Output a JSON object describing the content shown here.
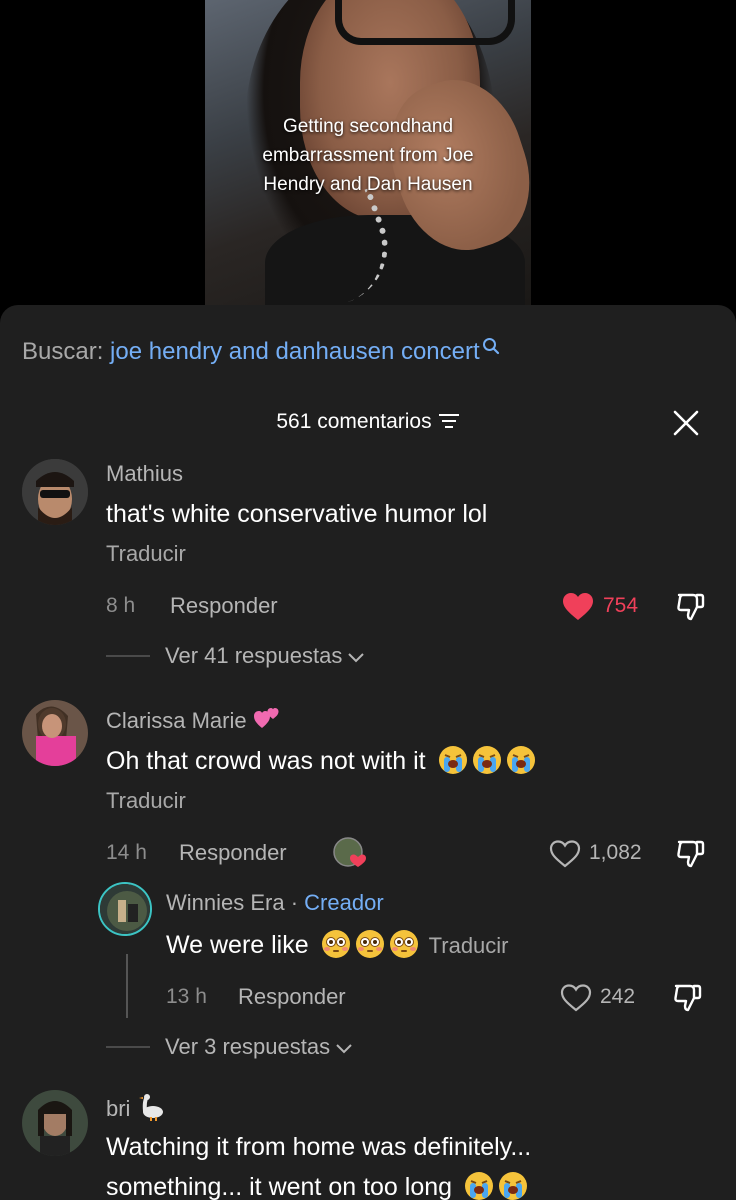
{
  "video": {
    "caption": "Getting secondhand embarrassment from Joe Hendry and Dan Hausen"
  },
  "search": {
    "prefix": "Buscar:",
    "query": "joe hendry and danhausen concert"
  },
  "comments_header": {
    "count_label": "561 comentarios"
  },
  "comments": [
    {
      "name": "Mathius",
      "text": "that's white conservative humor lol",
      "translate": "Traducir",
      "time": "8 h",
      "reply": "Responder",
      "likes": "754",
      "liked": true,
      "view_replies": "Ver 41 respuestas"
    },
    {
      "name": "Clarissa Marie",
      "text": "Oh that crowd was not with it",
      "translate": "Traducir",
      "time": "14 h",
      "reply": "Responder",
      "likes": "1,082",
      "liked": false,
      "reply_item": {
        "name": "Winnies Era",
        "separator": "·",
        "tag": "Creador",
        "text": "We were like",
        "translate": "Traducir",
        "time": "13 h",
        "reply": "Responder",
        "likes": "242"
      },
      "view_replies": "Ver 3 respuestas"
    },
    {
      "name": "bri",
      "text_line1": "Watching it from home was definitely...",
      "text_line2": "something... it went on too long"
    }
  ],
  "colors": {
    "sheet_bg": "#1f1f1f",
    "accent_blue": "#74aef5",
    "like_red": "#f0405a"
  }
}
